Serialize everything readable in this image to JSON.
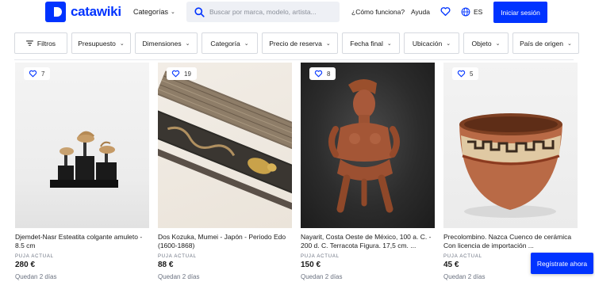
{
  "header": {
    "logo_text": "catawiki",
    "categories_label": "Categorías",
    "search_placeholder": "Buscar por marca, modelo, artista...",
    "how_it_works": "¿Cómo funciona?",
    "help": "Ayuda",
    "language": "ES",
    "signin_label": "Iniciar sesión",
    "brand_color": "#0033ff"
  },
  "filters": [
    {
      "label": "Filtros",
      "icon": "sliders-icon"
    },
    {
      "label": "Presupuesto"
    },
    {
      "label": "Dimensiones"
    },
    {
      "label": "Categoría"
    },
    {
      "label": "Precio de reserva"
    },
    {
      "label": "Fecha final"
    },
    {
      "label": "Ubicación"
    },
    {
      "label": "Objeto"
    },
    {
      "label": "País de origen"
    }
  ],
  "cards": [
    {
      "favorites": "7",
      "title": "Djemdet-Nasr Esteatita colgante amuleto - 8.5 cm",
      "bid_label": "PUJA ACTUAL",
      "price": "280 €",
      "remaining": "Quedan 2 días"
    },
    {
      "favorites": "19",
      "title": "Dos Kozuka, Mumei - Japón - Periodo Edo (1600-1868)",
      "bid_label": "PUJA ACTUAL",
      "price": "88 €",
      "remaining": "Quedan 2 días"
    },
    {
      "favorites": "8",
      "title": "Nayarit, Costa Oeste de México, 100 a. C. - 200 d. C. Terracota Figura. 17,5 cm. ...",
      "bid_label": "PUJA ACTUAL",
      "price": "150 €",
      "remaining": "Quedan 2 días"
    },
    {
      "favorites": "5",
      "title": "Precolombino. Nazca Cuenco de cerámica Con licencia de importación ...",
      "bid_label": "PUJA ACTUAL",
      "price": "45 €",
      "remaining": "Quedan 2 días"
    }
  ],
  "register_label": "Regístrate ahora"
}
